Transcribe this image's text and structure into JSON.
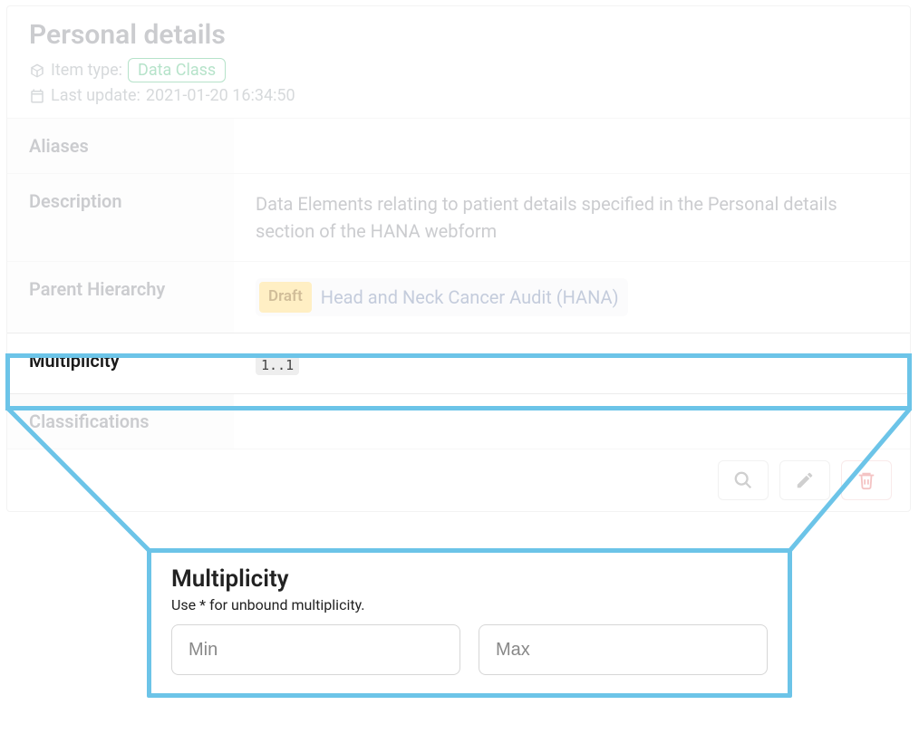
{
  "header": {
    "title": "Personal details",
    "item_type_label": "Item type:",
    "item_type_value": "Data Class",
    "last_update_label": "Last update:",
    "last_update_value": "2021-01-20 16:34:50"
  },
  "rows": {
    "aliases": {
      "key": "Aliases",
      "value": ""
    },
    "description": {
      "key": "Description",
      "value": "Data Elements relating to patient details specified in the Personal details section of the HANA webform"
    },
    "parent": {
      "key": "Parent Hierarchy",
      "draft": "Draft",
      "link": "Head and Neck Cancer Audit (HANA)"
    },
    "multiplicity": {
      "key": "Multiplicity",
      "value": "1..1"
    },
    "classifications": {
      "key": "Classifications",
      "value": ""
    }
  },
  "callout": {
    "title": "Multiplicity",
    "hint": "Use * for unbound multiplicity.",
    "min_placeholder": "Min",
    "max_placeholder": "Max"
  }
}
